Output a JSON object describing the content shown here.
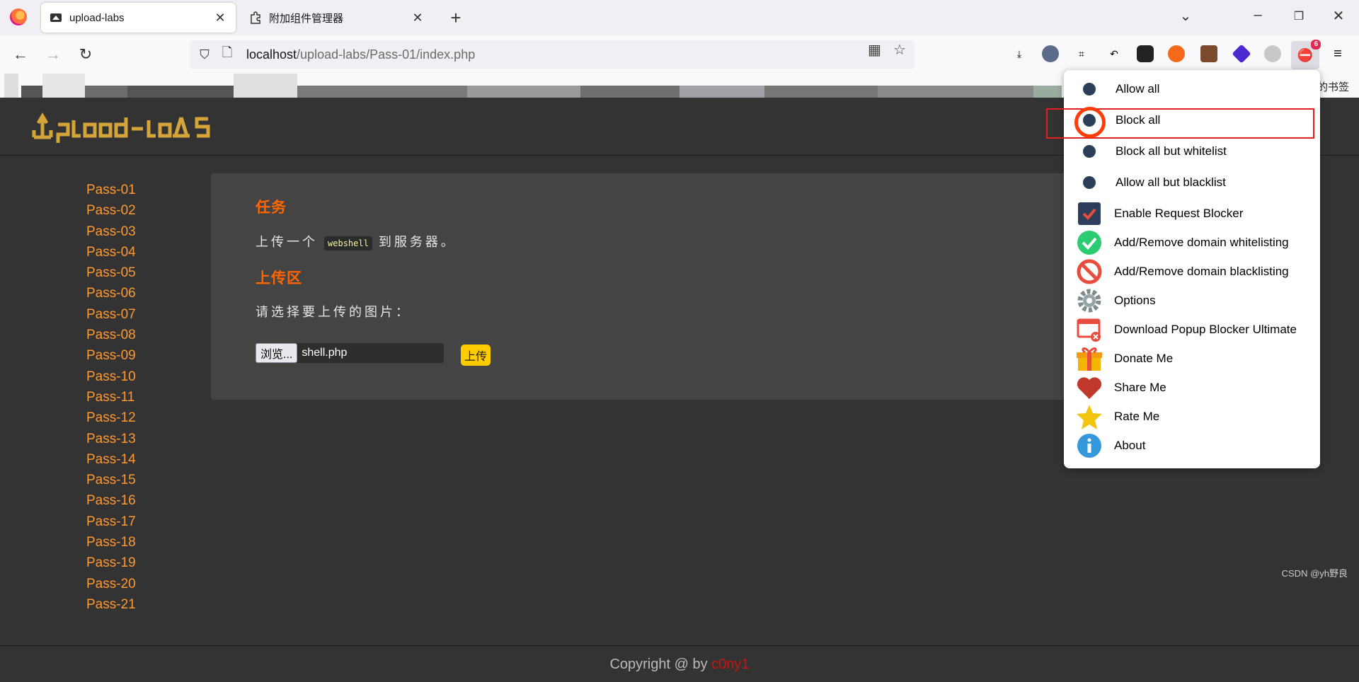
{
  "browser": {
    "tabs": [
      {
        "title": "upload-labs",
        "active": true
      },
      {
        "title": "附加组件管理器",
        "active": false
      }
    ],
    "url": {
      "host": "localhost",
      "path": "/upload-labs/Pass-01/index.php"
    },
    "extension_badge": "6",
    "bookmarks_right_label": "的书签"
  },
  "page": {
    "sidebar": [
      "Pass-01",
      "Pass-02",
      "Pass-03",
      "Pass-04",
      "Pass-05",
      "Pass-06",
      "Pass-07",
      "Pass-08",
      "Pass-09",
      "Pass-10",
      "Pass-11",
      "Pass-12",
      "Pass-13",
      "Pass-14",
      "Pass-15",
      "Pass-16",
      "Pass-17",
      "Pass-18",
      "Pass-19",
      "Pass-20",
      "Pass-21"
    ],
    "task_heading": "任务",
    "task_prefix": "上传一个",
    "task_code": "webshell",
    "task_suffix": "到服务器。",
    "upload_heading": "上传区",
    "upload_prompt": "请选择要上传的图片：",
    "browse_label": "浏览...",
    "file_name": "shell.php",
    "upload_button": "上传",
    "footer_prefix": "Copyright @  by ",
    "footer_author": "c0ny1"
  },
  "popup_menu": {
    "radio_items": [
      "Allow all",
      "Block all",
      "Block all but whitelist",
      "Allow all but blacklist"
    ],
    "selected": "Block all",
    "items": [
      {
        "label": "Enable Request Blocker",
        "icon": "checkbox-icon"
      },
      {
        "label": "Add/Remove domain whitelisting",
        "icon": "green-check-icon"
      },
      {
        "label": "Add/Remove domain blacklisting",
        "icon": "prohibited-icon"
      },
      {
        "label": "Options",
        "icon": "gear-icon"
      },
      {
        "label": "Download Popup Blocker Ultimate",
        "icon": "popup-window-icon"
      },
      {
        "label": "Donate Me",
        "icon": "gift-icon"
      },
      {
        "label": "Share Me",
        "icon": "heart-icon"
      },
      {
        "label": "Rate Me",
        "icon": "star-icon"
      },
      {
        "label": "About",
        "icon": "info-icon"
      }
    ]
  },
  "watermark": "CSDN @yh野良",
  "colors": {
    "accent_orange": "#ff6600",
    "link_orange": "#ff9933",
    "logo_gold": "#d4a63a",
    "highlight_red": "#e02020"
  }
}
